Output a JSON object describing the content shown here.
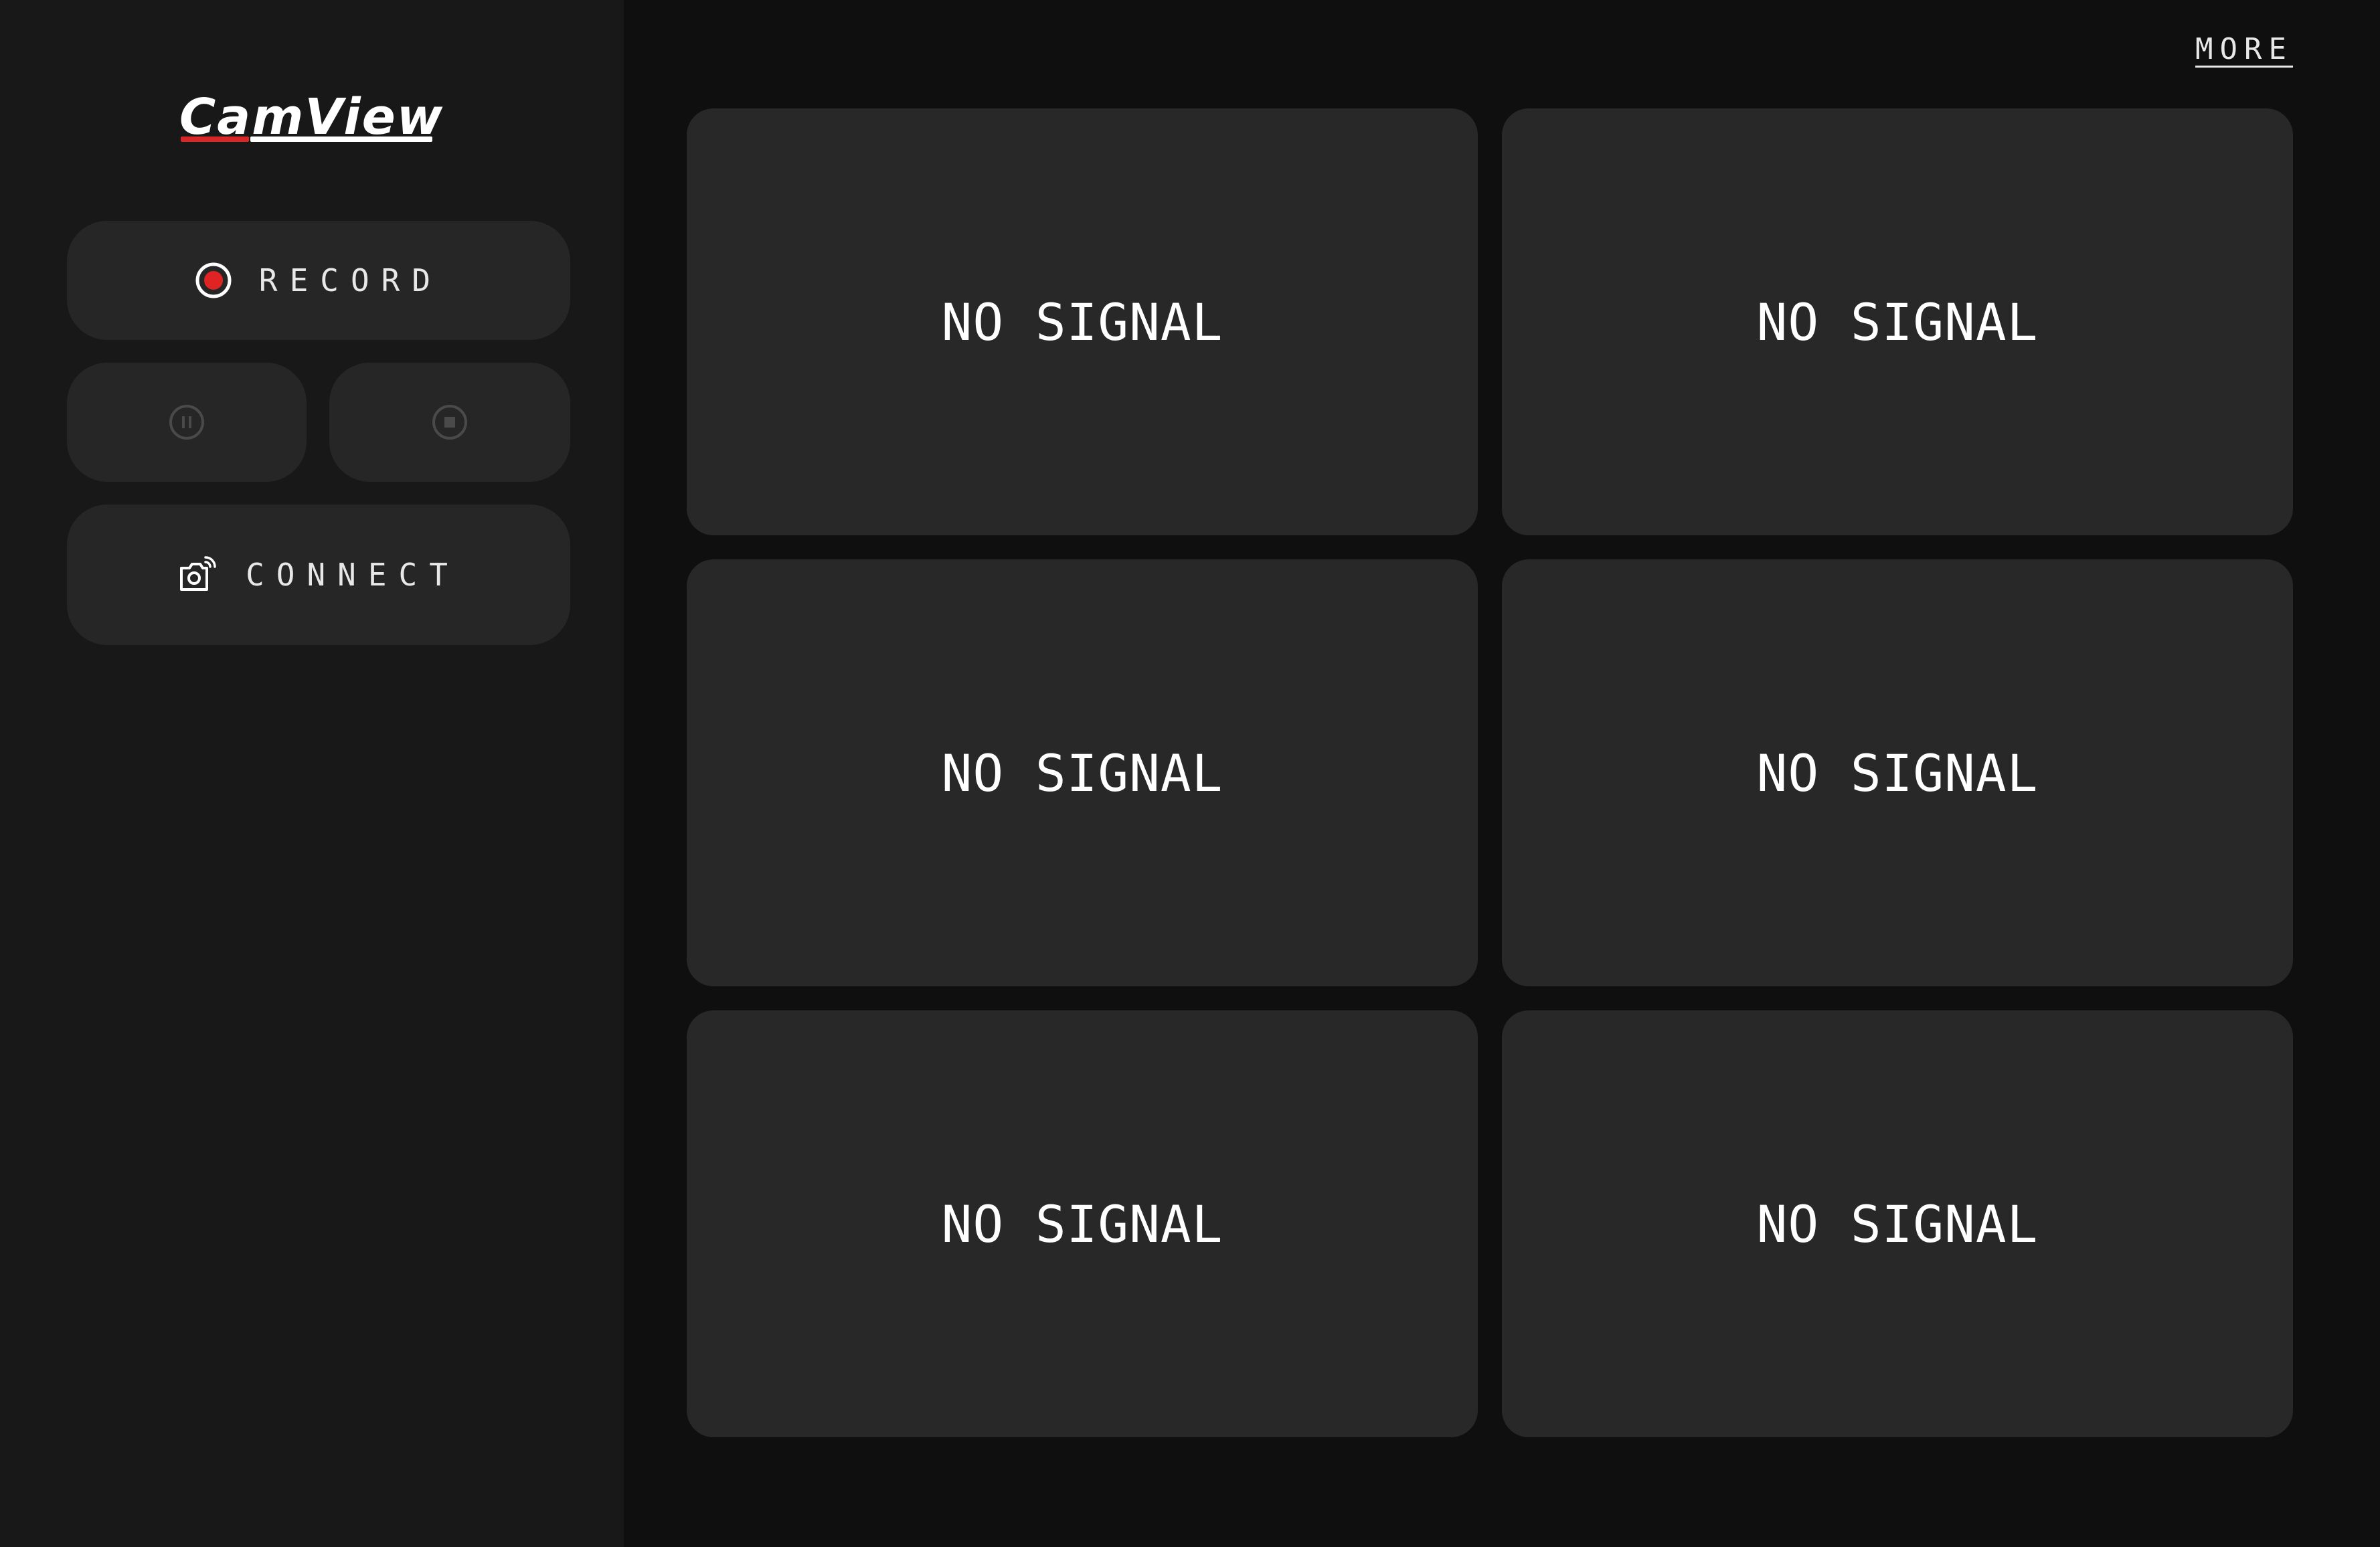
{
  "app": {
    "logo_text": "CamView",
    "accent_color": "#d62828"
  },
  "sidebar": {
    "record_label": "RECORD",
    "pause_icon": "pause-icon",
    "stop_icon": "stop-icon",
    "connect_label": "CONNECT"
  },
  "header": {
    "more_label": "MORE"
  },
  "tiles": [
    {
      "status": "NO SIGNAL"
    },
    {
      "status": "NO SIGNAL"
    },
    {
      "status": "NO SIGNAL"
    },
    {
      "status": "NO SIGNAL"
    },
    {
      "status": "NO SIGNAL"
    },
    {
      "status": "NO SIGNAL"
    }
  ]
}
